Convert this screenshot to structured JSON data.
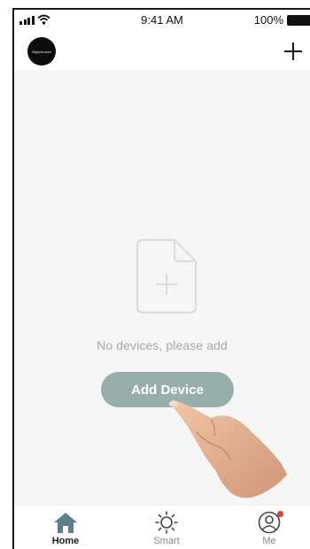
{
  "status_bar": {
    "time": "9:41 AM",
    "battery_percent": "100%",
    "signal-icon": "signal-bars-icon",
    "wifi-icon": "wifi-icon"
  },
  "header": {
    "brand_logo_text": "Stylehouse",
    "add_icon": "plus-icon"
  },
  "empty_state": {
    "icon": "add-document-icon",
    "message": "No devices, please add",
    "button_label": "Add Device"
  },
  "tabs": [
    {
      "label": "Home",
      "icon": "home-icon",
      "active": true
    },
    {
      "label": "Smart",
      "icon": "sun-icon",
      "active": false
    },
    {
      "label": "Me",
      "icon": "profile-icon",
      "active": false,
      "badge": true
    }
  ],
  "colors": {
    "accent_button": "#98aeab",
    "home_icon_active": "#5f7f86",
    "notification_dot": "#ee3b2b"
  }
}
